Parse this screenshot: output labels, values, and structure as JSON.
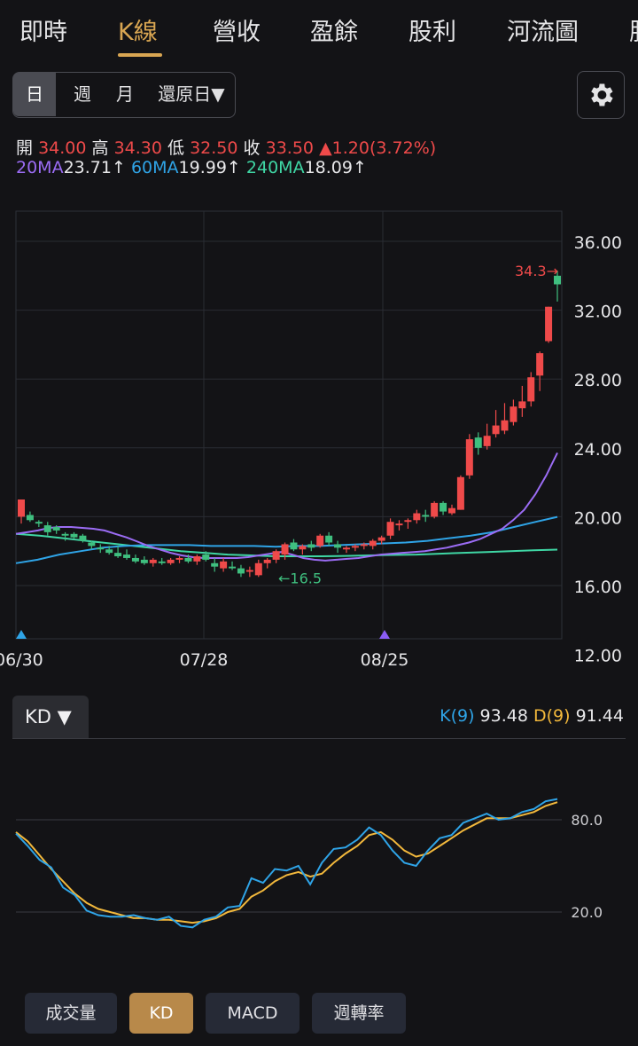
{
  "tabs": [
    "即時",
    "K線",
    "營收",
    "盈餘",
    "股利",
    "河流圖",
    "股"
  ],
  "active_tab": 1,
  "periods": [
    "日",
    "週",
    "月",
    "還原日▼"
  ],
  "active_period": 0,
  "icons": {
    "settings": "gear-icon"
  },
  "ohlc": {
    "open_label": "開",
    "open": "34.00",
    "high_label": "高",
    "high": "34.30",
    "low_label": "低",
    "low": "32.50",
    "close_label": "收",
    "close": "33.50",
    "change": "▲1.20(3.72%)"
  },
  "ma": {
    "ma20_label": "20MA",
    "ma20": "23.71↑",
    "ma60_label": "60MA",
    "ma60": "19.99↑",
    "ma240_label": "240MA",
    "ma240": "18.09↑"
  },
  "colors": {
    "up": "#ef4a4a",
    "down": "#3fbf7f",
    "ma20": "#9b6cf4",
    "ma60": "#2fa4e7",
    "ma240": "#3fd6a4",
    "k": "#2fa4e7",
    "d": "#f2b83c",
    "accent": "#d9a652"
  },
  "price_chart": {
    "y_ticks": [
      "36.00",
      "32.00",
      "28.00",
      "24.00",
      "20.00",
      "16.00",
      "12.00"
    ],
    "x_ticks": [
      "06/30",
      "07/28",
      "08/25"
    ],
    "high_annotation": "34.3→",
    "low_annotation": "←16.5"
  },
  "indicator": {
    "selector": "KD ▼",
    "k_label": "K(9)",
    "k_value": "93.48",
    "d_label": "D(9)",
    "d_value": "91.44",
    "y_ticks": [
      "80.0",
      "20.0"
    ]
  },
  "chart_data": [
    {
      "type": "candlestick",
      "x_ticks": [
        "06/30",
        "07/28",
        "08/25"
      ],
      "ylim": [
        12,
        37
      ],
      "y_ticks": [
        36,
        32,
        28,
        24,
        20,
        16,
        12
      ],
      "candles": [
        [
          20.0,
          21.0,
          19.6,
          21.0
        ],
        [
          20.1,
          20.3,
          19.7,
          19.8
        ],
        [
          19.7,
          19.8,
          19.4,
          19.6
        ],
        [
          19.5,
          19.7,
          18.9,
          19.1
        ],
        [
          19.4,
          19.5,
          19.0,
          19.2
        ],
        [
          19.0,
          19.1,
          18.6,
          18.9
        ],
        [
          19.0,
          19.1,
          18.7,
          18.8
        ],
        [
          18.9,
          19.0,
          18.5,
          18.6
        ],
        [
          18.5,
          18.6,
          18.1,
          18.3
        ],
        [
          18.2,
          18.4,
          17.9,
          18.1
        ],
        [
          18.1,
          18.3,
          17.8,
          17.9
        ],
        [
          17.9,
          18.3,
          17.6,
          17.7
        ],
        [
          17.8,
          18.1,
          17.5,
          17.6
        ],
        [
          17.6,
          17.8,
          17.3,
          17.4
        ],
        [
          17.5,
          17.7,
          17.2,
          17.3
        ],
        [
          17.3,
          17.6,
          17.1,
          17.5
        ],
        [
          17.4,
          17.6,
          17.2,
          17.3
        ],
        [
          17.3,
          17.6,
          17.2,
          17.5
        ],
        [
          17.5,
          17.7,
          17.3,
          17.6
        ],
        [
          17.6,
          17.8,
          17.3,
          17.4
        ],
        [
          17.4,
          17.8,
          17.2,
          17.7
        ],
        [
          17.8,
          18.0,
          17.4,
          17.5
        ],
        [
          17.3,
          17.6,
          16.8,
          17.1
        ],
        [
          17.0,
          17.6,
          16.8,
          17.4
        ],
        [
          17.1,
          17.4,
          16.9,
          17.0
        ],
        [
          17.0,
          17.2,
          16.5,
          16.7
        ],
        [
          16.8,
          17.1,
          16.5,
          16.9
        ],
        [
          16.6,
          17.5,
          16.5,
          17.3
        ],
        [
          17.3,
          17.6,
          17.0,
          17.5
        ],
        [
          17.5,
          18.1,
          17.3,
          18.0
        ],
        [
          17.8,
          18.5,
          17.5,
          18.4
        ],
        [
          18.5,
          18.7,
          18.0,
          18.1
        ],
        [
          18.1,
          18.4,
          17.8,
          18.3
        ],
        [
          18.4,
          18.6,
          18.0,
          18.2
        ],
        [
          18.3,
          19.0,
          18.2,
          18.9
        ],
        [
          18.9,
          19.1,
          18.3,
          18.5
        ],
        [
          18.4,
          18.6,
          17.9,
          18.2
        ],
        [
          18.1,
          18.3,
          17.9,
          18.2
        ],
        [
          18.2,
          18.4,
          18.0,
          18.3
        ],
        [
          18.3,
          18.5,
          18.1,
          18.4
        ],
        [
          18.3,
          18.7,
          18.1,
          18.6
        ],
        [
          18.6,
          18.9,
          18.4,
          18.8
        ],
        [
          18.9,
          19.9,
          18.7,
          19.7
        ],
        [
          19.5,
          19.8,
          19.2,
          19.6
        ],
        [
          19.7,
          19.9,
          19.3,
          19.8
        ],
        [
          19.8,
          20.4,
          19.6,
          20.2
        ],
        [
          20.1,
          20.4,
          19.7,
          20.0
        ],
        [
          20.0,
          20.9,
          19.9,
          20.8
        ],
        [
          20.8,
          20.9,
          20.1,
          20.3
        ],
        [
          20.2,
          20.7,
          20.1,
          20.5
        ],
        [
          20.4,
          22.4,
          20.4,
          22.3
        ],
        [
          22.4,
          24.8,
          22.2,
          24.5
        ],
        [
          24.6,
          24.9,
          23.6,
          24.0
        ],
        [
          24.1,
          25.4,
          23.9,
          24.7
        ],
        [
          24.8,
          26.2,
          24.6,
          25.3
        ],
        [
          25.0,
          26.6,
          24.8,
          25.6
        ],
        [
          25.5,
          26.8,
          25.3,
          26.4
        ],
        [
          26.3,
          27.6,
          25.8,
          26.7
        ],
        [
          26.7,
          28.4,
          26.4,
          28.1
        ],
        [
          28.2,
          29.6,
          27.3,
          29.5
        ],
        [
          30.2,
          32.2,
          30.1,
          32.2
        ],
        [
          34.0,
          34.3,
          32.5,
          33.5
        ]
      ],
      "ma20": [
        19.0,
        19.1,
        19.2,
        19.35,
        19.4,
        19.4,
        19.35,
        19.3,
        19.2,
        19.0,
        18.8,
        18.55,
        18.3,
        18.1,
        17.9,
        17.75,
        17.65,
        17.6,
        17.6,
        17.6,
        17.6,
        17.65,
        17.75,
        17.85,
        17.95,
        17.8,
        17.6,
        17.5,
        17.45,
        17.5,
        17.55,
        17.6,
        17.7,
        17.8,
        17.85,
        17.9,
        17.95,
        18.0,
        18.1,
        18.2,
        18.35,
        18.5,
        18.7,
        19.0,
        19.3,
        19.8,
        20.4,
        21.3,
        22.4,
        23.71
      ],
      "ma60": [
        17.3,
        17.5,
        17.8,
        18.0,
        18.2,
        18.3,
        18.35,
        18.35,
        18.35,
        18.3,
        18.3,
        18.3,
        18.25,
        18.3,
        18.3,
        18.35,
        18.4,
        18.45,
        18.5,
        18.6,
        18.75,
        18.9,
        19.1,
        19.4,
        19.7,
        19.99
      ],
      "ma240": [
        19.0,
        18.9,
        18.75,
        18.6,
        18.45,
        18.3,
        18.15,
        18.0,
        17.9,
        17.8,
        17.75,
        17.7,
        17.7,
        17.7,
        17.72,
        17.75,
        17.78,
        17.8,
        17.85,
        17.9,
        17.95,
        18.0,
        18.05,
        18.09
      ],
      "high_label": "34.3",
      "low_label": "16.5"
    },
    {
      "type": "line",
      "title": "KD",
      "y_ticks": [
        80.0,
        20.0
      ],
      "series": [
        {
          "name": "K(9)",
          "values": [
            71,
            63,
            54,
            49,
            36,
            31,
            21,
            18,
            17,
            17,
            18,
            16,
            15,
            17,
            11,
            10,
            15,
            17,
            23,
            24,
            42,
            39,
            48,
            47,
            50,
            38,
            52,
            61,
            62,
            67,
            75,
            70,
            60,
            52,
            50,
            60,
            68,
            70,
            78,
            81,
            84,
            80,
            81,
            85,
            87,
            92,
            93.48
          ]
        },
        {
          "name": "D(9)",
          "values": [
            72,
            66,
            57,
            48,
            40,
            32,
            26,
            22,
            20,
            18,
            16,
            16,
            15,
            15,
            14,
            13,
            14,
            16,
            20,
            22,
            30,
            34,
            40,
            44,
            46,
            43,
            45,
            52,
            58,
            63,
            70,
            72,
            67,
            60,
            56,
            58,
            63,
            68,
            73,
            77,
            81,
            81,
            81,
            83,
            85,
            89,
            91.44
          ]
        }
      ]
    }
  ],
  "bottom_buttons": [
    "成交量",
    "KD",
    "MACD",
    "週轉率"
  ],
  "active_bottom": 1
}
